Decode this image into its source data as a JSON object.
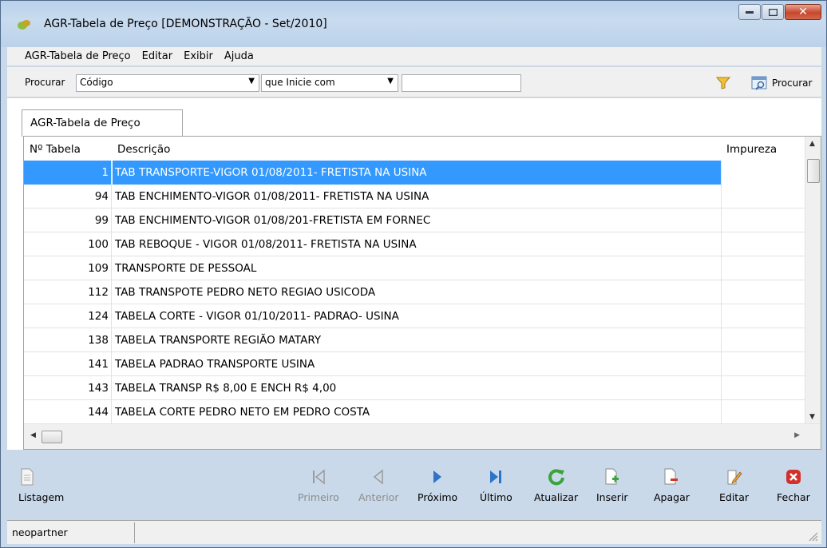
{
  "window": {
    "title": "AGR-Tabela de Preço [DEMONSTRAÇÃO - Set/2010]"
  },
  "menu": [
    "AGR-Tabela de Preço",
    "Editar",
    "Exibir",
    "Ajuda"
  ],
  "search": {
    "label": "Procurar",
    "field": "Código",
    "mode": "que Inicie com",
    "value": "",
    "button": "Procurar"
  },
  "tab": {
    "label": "AGR-Tabela de Preço"
  },
  "grid": {
    "headers": {
      "num": "Nº Tabela",
      "desc": "Descrição",
      "imp": "Impureza"
    },
    "rows": [
      {
        "num": "1",
        "desc": "TAB TRANSPORTE-VIGOR 01/08/2011- FRETISTA NA USINA"
      },
      {
        "num": "94",
        "desc": "TAB ENCHIMENTO-VIGOR 01/08/2011- FRETISTA NA USINA"
      },
      {
        "num": "99",
        "desc": "TAB ENCHIMENTO-VIGOR 01/08/201-FRETISTA EM FORNEC"
      },
      {
        "num": "100",
        "desc": "TAB REBOQUE -  VIGOR 01/08/2011- FRETISTA NA USINA"
      },
      {
        "num": "109",
        "desc": "TRANSPORTE DE PESSOAL"
      },
      {
        "num": "112",
        "desc": "TAB TRANSPOTE PEDRO NETO REGIAO USICODA"
      },
      {
        "num": "124",
        "desc": "TABELA CORTE  -   VIGOR 01/10/2011- PADRAO- USINA"
      },
      {
        "num": "138",
        "desc": "TABELA TRANSPORTE REGIÃO MATARY"
      },
      {
        "num": "141",
        "desc": "TABELA PADRAO TRANSPORTE USINA"
      },
      {
        "num": "143",
        "desc": "TABELA TRANSP  R$ 8,00 E ENCH R$ 4,00"
      },
      {
        "num": "144",
        "desc": "TABELA CORTE PEDRO NETO  EM PEDRO COSTA"
      }
    ]
  },
  "toolbar": {
    "listagem": "Listagem",
    "primeiro": "Primeiro",
    "anterior": "Anterior",
    "proximo": "Próximo",
    "ultimo": "Último",
    "atualizar": "Atualizar",
    "inserir": "Inserir",
    "apagar": "Apagar",
    "editar": "Editar",
    "fechar": "Fechar"
  },
  "status": {
    "user": "neopartner"
  }
}
